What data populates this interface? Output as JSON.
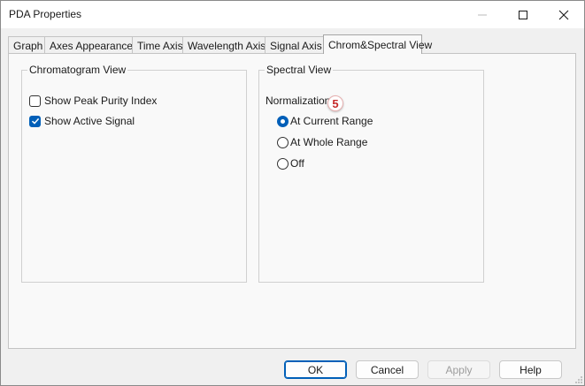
{
  "window": {
    "title": "PDA Properties"
  },
  "tabs": [
    {
      "label": "Graph"
    },
    {
      "label": "Axes Appearance"
    },
    {
      "label": "Time Axis"
    },
    {
      "label": "Wavelength Axis"
    },
    {
      "label": "Signal Axis"
    },
    {
      "label": "Chrom&Spectral View"
    }
  ],
  "active_tab": "Chrom&Spectral View",
  "chromatogram_view": {
    "title": "Chromatogram View",
    "options": [
      {
        "label": "Show Peak Purity Index",
        "checked": false
      },
      {
        "label": "Show Active Signal",
        "checked": true
      }
    ]
  },
  "spectral_view": {
    "title": "Spectral View",
    "normalization_label": "Normalization:",
    "options": [
      {
        "label": "At Current Range",
        "selected": true
      },
      {
        "label": "At Whole Range",
        "selected": false
      },
      {
        "label": "Off",
        "selected": false
      }
    ]
  },
  "annotation": {
    "number": "5"
  },
  "buttons": {
    "ok": "OK",
    "cancel": "Cancel",
    "apply": "Apply",
    "help": "Help"
  },
  "colors": {
    "accent": "#005fb8",
    "badge": "#c62828"
  }
}
